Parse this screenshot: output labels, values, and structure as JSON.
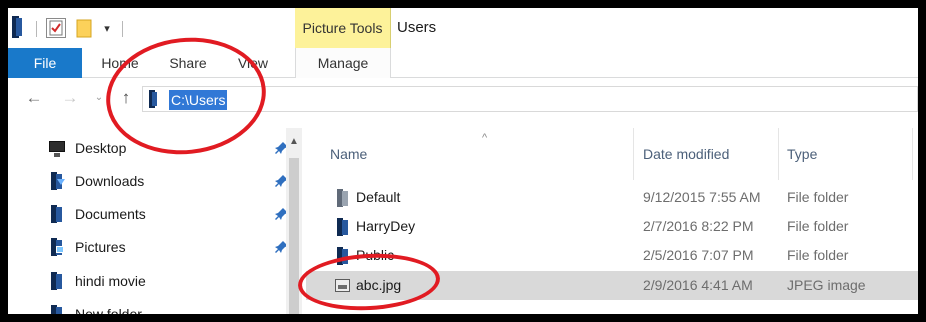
{
  "title_bar": {
    "context_tab_header": "Picture Tools",
    "window_title": "Users",
    "quick_access_dropdown_glyph": "▾",
    "icons": [
      "library-icon",
      "properties-icon",
      "new-folder-icon",
      "customize-dropdown-icon"
    ]
  },
  "ribbon": {
    "tabs": [
      {
        "label": "File"
      },
      {
        "label": "Home"
      },
      {
        "label": "Share"
      },
      {
        "label": "View"
      },
      {
        "label": "Manage"
      }
    ],
    "file_tab_color": "#1979ca",
    "context_tab_color": "#fdf29a"
  },
  "navigation": {
    "back_glyph": "←",
    "forward_glyph": "→",
    "recent_glyph": "⌄",
    "up_glyph": "↑",
    "address": "C:\\Users",
    "selection_color": "#3178d6"
  },
  "nav_pane": {
    "items": [
      {
        "label": "Desktop",
        "icon": "desktop-icon",
        "pinned": true
      },
      {
        "label": "Downloads",
        "icon": "downloads-icon",
        "pinned": true
      },
      {
        "label": "Documents",
        "icon": "documents-icon",
        "pinned": true
      },
      {
        "label": "Pictures",
        "icon": "pictures-icon",
        "pinned": true
      },
      {
        "label": "hindi movie",
        "icon": "library-icon",
        "pinned": false
      },
      {
        "label": "New folder",
        "icon": "library-icon",
        "pinned": false
      }
    ],
    "scroll_up_glyph": "▲"
  },
  "file_list": {
    "columns": {
      "name": "Name",
      "date": "Date modified",
      "type": "Type"
    },
    "sort_glyph": "^",
    "rows": [
      {
        "name": "Default",
        "date": "9/12/2015 7:55 AM",
        "type": "File folder",
        "icon": "user-folder-icon",
        "selected": false
      },
      {
        "name": "HarryDey",
        "date": "2/7/2016 8:22 PM",
        "type": "File folder",
        "icon": "user-folder-icon",
        "selected": false
      },
      {
        "name": "Public",
        "date": "2/5/2016 7:07 PM",
        "type": "File folder",
        "icon": "user-folder-icon",
        "selected": false
      },
      {
        "name": "abc.jpg",
        "date": "2/9/2016 4:41 AM",
        "type": "JPEG image",
        "icon": "image-file-icon",
        "selected": true
      }
    ]
  },
  "annotations": {
    "color": "#e11b22"
  }
}
